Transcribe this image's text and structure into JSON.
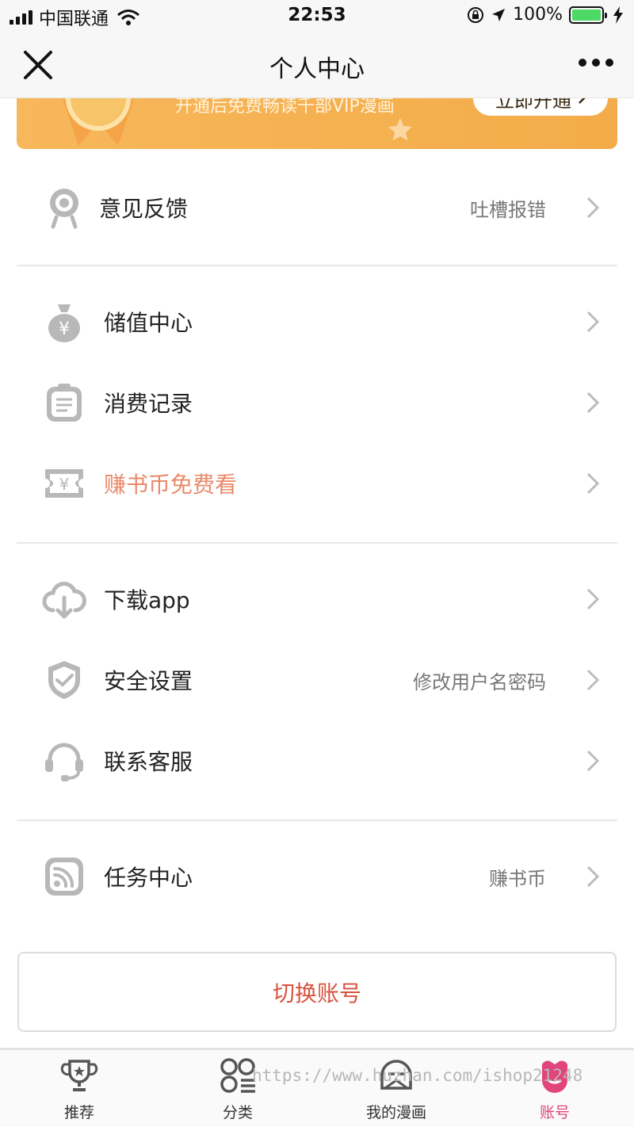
{
  "status_bar": {
    "carrier": "中国联通",
    "time": "22:53",
    "battery_percent": "100%"
  },
  "nav": {
    "title": "个人中心"
  },
  "vip_banner": {
    "text": "开通后免费畅读千部VIP漫画",
    "button_label": "立即开通"
  },
  "menu": {
    "feedback": {
      "label": "意见反馈",
      "sub": "吐槽报错"
    },
    "recharge": {
      "label": "储值中心"
    },
    "records": {
      "label": "消费记录"
    },
    "earn": {
      "label": "赚书币免费看"
    },
    "download": {
      "label": "下载app"
    },
    "security": {
      "label": "安全设置",
      "sub": "修改用户名密码"
    },
    "service": {
      "label": "联系客服"
    },
    "tasks": {
      "label": "任务中心",
      "sub": "赚书币"
    }
  },
  "switch_account_label": "切换账号",
  "tabs": [
    {
      "label": "推荐",
      "icon": "trophy-icon"
    },
    {
      "label": "分类",
      "icon": "category-icon"
    },
    {
      "label": "我的漫画",
      "icon": "my-comics-icon"
    },
    {
      "label": "账号",
      "icon": "account-icon",
      "active": true
    }
  ],
  "watermark": "https://www.huzhan.com/ishop21248",
  "colors": {
    "accent_pink": "#e0457b",
    "switch_red": "#d9533f",
    "earn_orange": "#e8896a",
    "banner_orange": "#f5b04f"
  }
}
